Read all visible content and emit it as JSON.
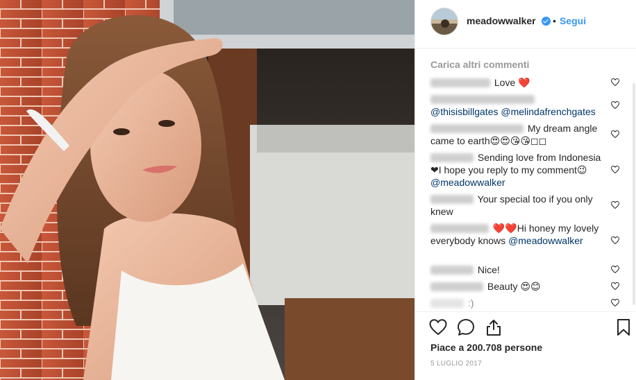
{
  "post": {
    "username": "meadowwalker",
    "verified_icon": "verified-badge-icon",
    "separator": "•",
    "follow_label": "Segui"
  },
  "comments_section": {
    "load_more_label": "Carica altri commenti",
    "items": [
      {
        "text": "Love ❤️",
        "mention": ""
      },
      {
        "text": "",
        "mention": "@thisisbillgates @melindafrenchgates"
      },
      {
        "text": "My dream angle came to earth😍😍😘😘◻◻",
        "mention": ""
      },
      {
        "text": "Sending love from Indonesia❤I hope you reply to my comment😉",
        "mention": "@meadowwalker"
      },
      {
        "text": "Your special too if you only knew",
        "mention": ""
      },
      {
        "text": "❤️❤️Hi honey my lovely everybody knows",
        "mention": "@meadowwalker"
      },
      {
        "text": "Nice!",
        "mention": ""
      },
      {
        "text": "Beauty 😍😊",
        "mention": ""
      },
      {
        "text": ":)",
        "mention": ""
      }
    ]
  },
  "actions": {
    "like_icon": "heart-icon",
    "comment_icon": "comment-icon",
    "share_icon": "share-icon",
    "save_icon": "bookmark-icon",
    "likes_text": "Piace a 200.708 persone",
    "date_text": "5 LUGLIO 2017"
  },
  "colors": {
    "link_blue": "#3897f0",
    "mention_blue": "#003569",
    "muted_gray": "#999999",
    "text_dark": "#262626"
  }
}
